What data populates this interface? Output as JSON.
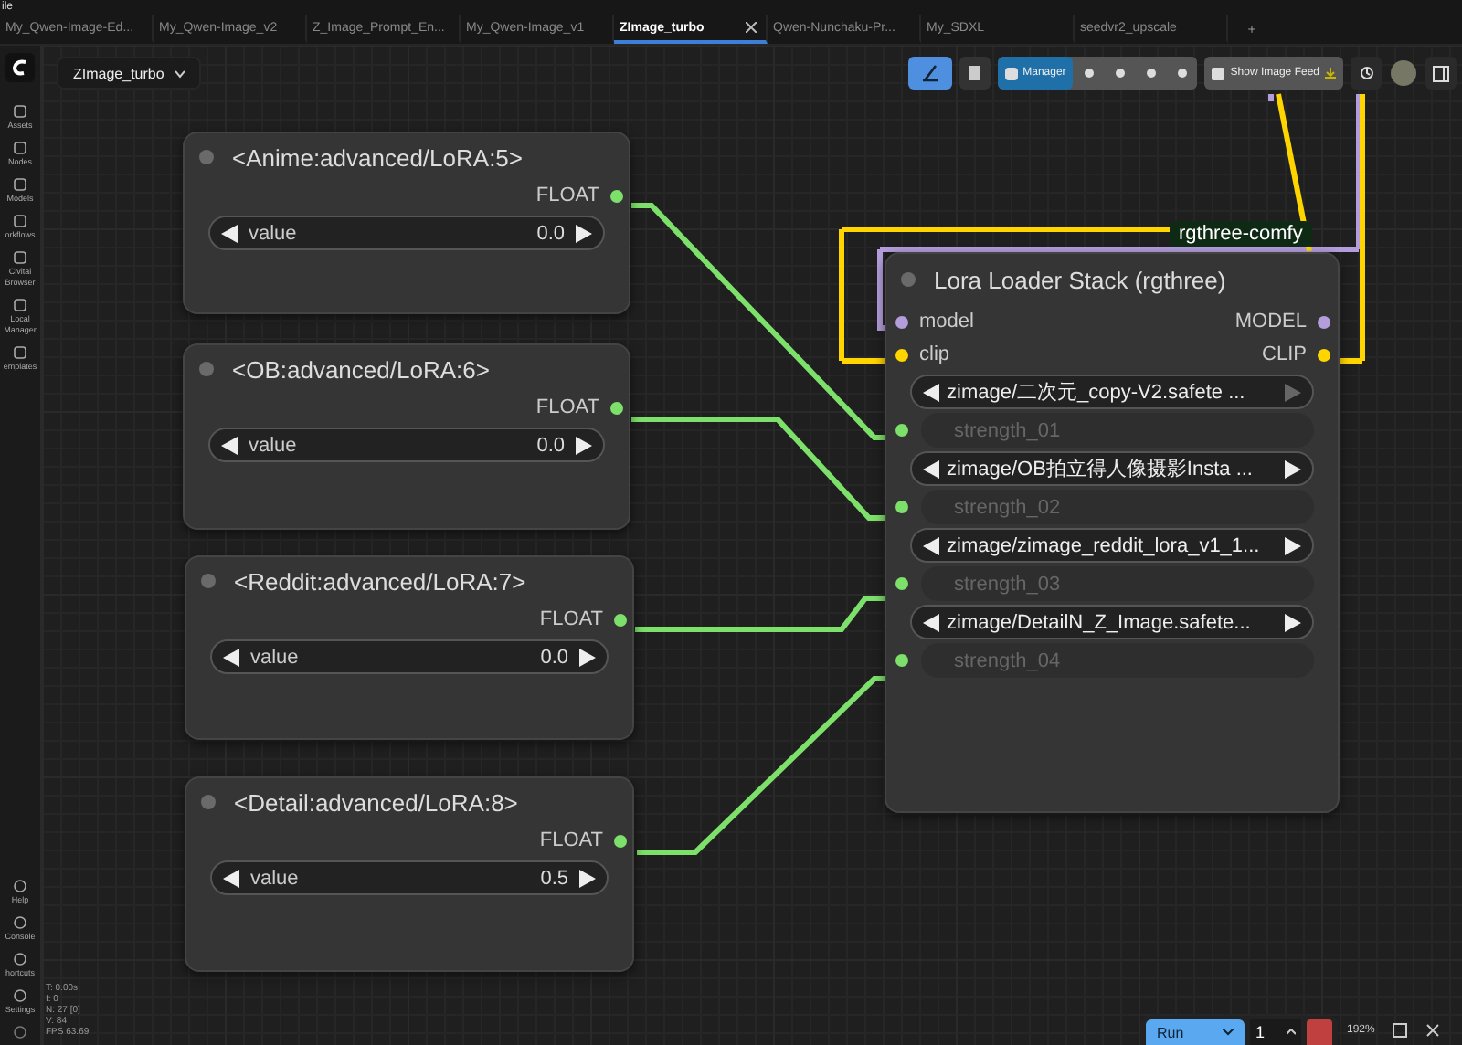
{
  "menu_text": "ile",
  "tabs": [
    {
      "label": "My_Qwen-Image-Ed...",
      "selected": false
    },
    {
      "label": "My_Qwen-Image_v2",
      "selected": false
    },
    {
      "label": "Z_Image_Prompt_En...",
      "selected": false
    },
    {
      "label": "My_Qwen-Image_v1",
      "selected": false
    },
    {
      "label": "ZImage_turbo",
      "selected": true
    },
    {
      "label": "Qwen-Nunchaku-Pr...",
      "selected": false
    },
    {
      "label": "My_SDXL",
      "selected": false
    },
    {
      "label": "seedvr2_upscale",
      "selected": false
    }
  ],
  "workflow": {
    "name": "ZImage_turbo"
  },
  "toolbar": {
    "manager": "Manager",
    "image_feed": "Show Image Feed"
  },
  "sidebar": {
    "top": [
      [
        "Assets"
      ],
      [
        "Nodes"
      ],
      [
        "Models"
      ],
      [
        "orkflows"
      ],
      [
        "Civitai",
        "Browser"
      ],
      [
        "Local",
        "Manager"
      ],
      [
        "emplates"
      ]
    ],
    "bottom": [
      [
        "Help"
      ],
      [
        "Console"
      ],
      [
        "hortcuts"
      ],
      [
        "Settings"
      ]
    ]
  },
  "stats": [
    "T: 0.00s",
    "I: 0",
    "N: 27 [0]",
    "V: 84",
    "FPS 63.69"
  ],
  "nodes": [
    {
      "title": "<Anime:advanced/LoRA:5>",
      "output": "FLOAT",
      "widget": {
        "label": "value",
        "value": "0.0"
      }
    },
    {
      "title": "<OB:advanced/LoRA:6>",
      "output": "FLOAT",
      "widget": {
        "label": "value",
        "value": "0.0"
      }
    },
    {
      "title": "<Reddit:advanced/LoRA:7>",
      "output": "FLOAT",
      "widget": {
        "label": "value",
        "value": "0.0"
      }
    },
    {
      "title": "<Detail:advanced/LoRA:8>",
      "output": "FLOAT",
      "widget": {
        "label": "value",
        "value": "0.5"
      }
    }
  ],
  "lora_stack": {
    "badge": "rgthree-comfy",
    "title": "Lora Loader Stack (rgthree)",
    "ports": [
      {
        "input": "model",
        "output": "MODEL",
        "color": "#b39ddb"
      },
      {
        "input": "clip",
        "output": "CLIP",
        "color": "#ffd500"
      }
    ],
    "loras": [
      {
        "name": "zimage/二次元_copy-V2.safete ...",
        "strength": "strength_01",
        "next_disabled": true
      },
      {
        "name": "zimage/OB拍立得人像摄影Insta ...",
        "strength": "strength_02",
        "next_disabled": false
      },
      {
        "name": "zimage/zimage_reddit_lora_v1_1...",
        "strength": "strength_03",
        "next_disabled": false
      },
      {
        "name": "zimage/DetailN_Z_Image.safete...",
        "strength": "strength_04",
        "next_disabled": false
      }
    ]
  },
  "run_bar": {
    "run": "Run",
    "count": "1",
    "zoom": "192%"
  }
}
